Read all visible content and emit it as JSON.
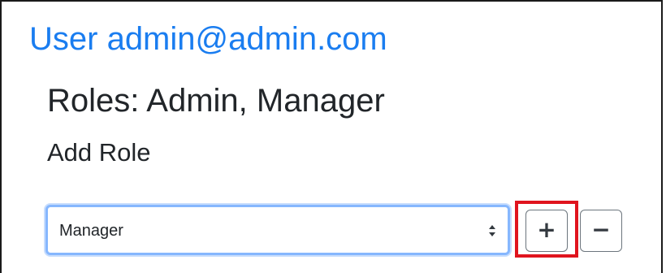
{
  "header": {
    "user_title": "User admin@admin.com",
    "roles_heading": "Roles: Admin, Manager",
    "add_role_heading": "Add Role"
  },
  "role_select": {
    "selected_value": "Manager"
  },
  "actions": {
    "add_label": "+",
    "remove_label": "−"
  },
  "colors": {
    "title_blue": "#1a7df0",
    "focus_border": "#86b7fe",
    "highlight_red": "#e0141e"
  },
  "icons": {
    "select_arrows": "updown-caret-icon"
  }
}
